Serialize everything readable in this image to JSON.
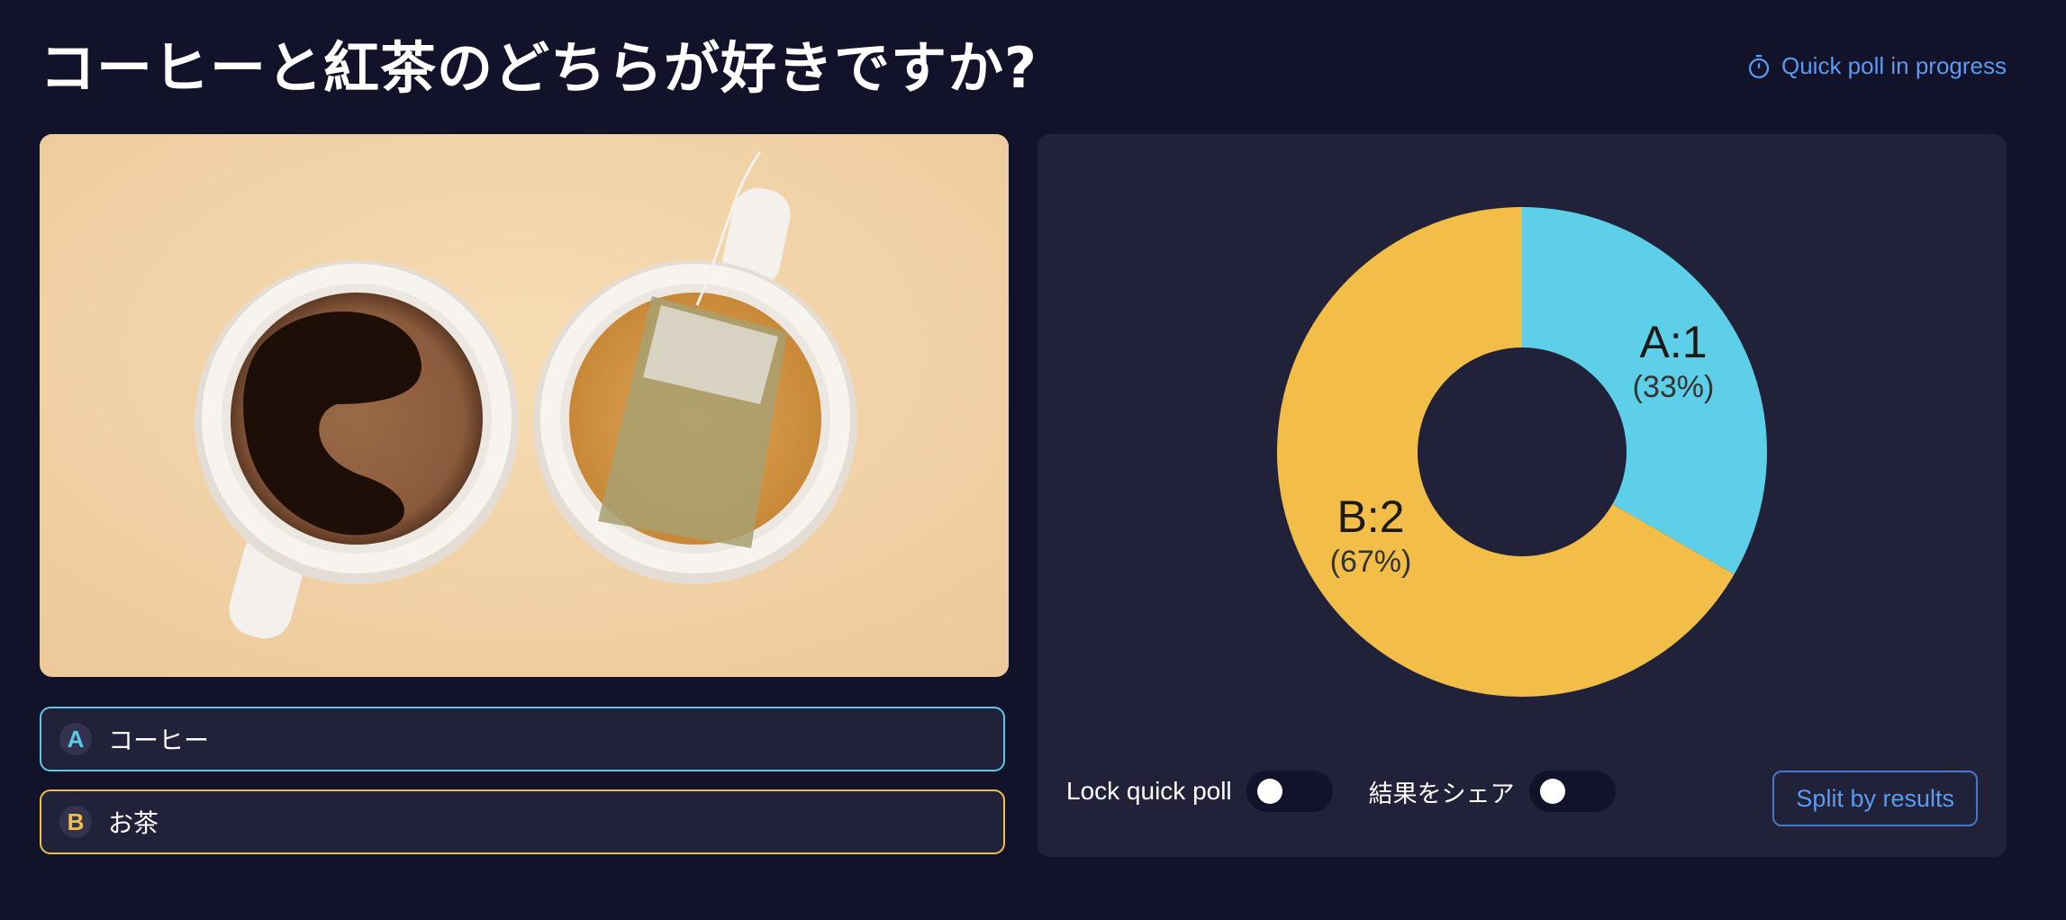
{
  "header": {
    "title": "コーヒーと紅茶のどちらが好きですか?",
    "status_label": "Quick poll in progress",
    "status_icon": "stopwatch-icon"
  },
  "image": {
    "subject": "coffee-and-tea-cups-photo"
  },
  "options": [
    {
      "letter": "A",
      "text": "コーヒー",
      "color": "#5cc9e6"
    },
    {
      "letter": "B",
      "text": "お茶",
      "color": "#f0be4a"
    }
  ],
  "chart_data": {
    "type": "pie",
    "donut": true,
    "categories": [
      "A",
      "B"
    ],
    "values": [
      1,
      2
    ],
    "percent_labels": [
      "(33%)",
      "(67%)"
    ],
    "value_labels": [
      "A:1",
      "B:2"
    ],
    "colors": [
      "#5ecfe8",
      "#f2be48"
    ]
  },
  "controls": {
    "lock_label": "Lock quick poll",
    "lock_on": false,
    "share_label": "結果をシェア",
    "share_on": false,
    "split_button": "Split by results"
  },
  "colors": {
    "background": "#12122a",
    "panel": "#21213a",
    "accent": "#5b9bf0"
  }
}
